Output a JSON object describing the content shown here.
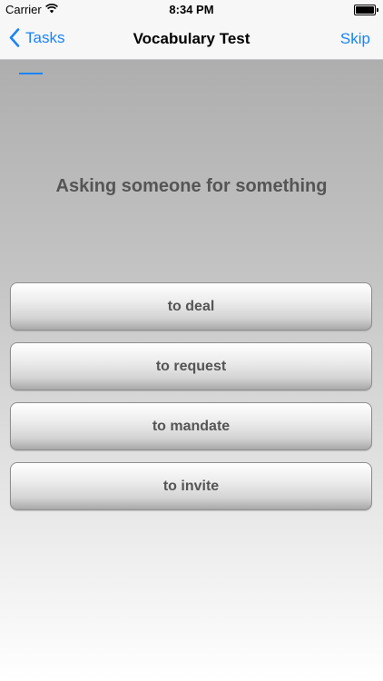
{
  "status_bar": {
    "carrier": "Carrier",
    "time": "8:34 PM"
  },
  "nav": {
    "back_label": "Tasks",
    "title": "Vocabulary Test",
    "skip_label": "Skip"
  },
  "quiz": {
    "prompt": "Asking someone for something",
    "answers": [
      {
        "label": "to deal"
      },
      {
        "label": "to request"
      },
      {
        "label": "to mandate"
      },
      {
        "label": "to invite"
      }
    ]
  },
  "colors": {
    "accent": "#1a84f6",
    "text_gray": "#555555"
  }
}
